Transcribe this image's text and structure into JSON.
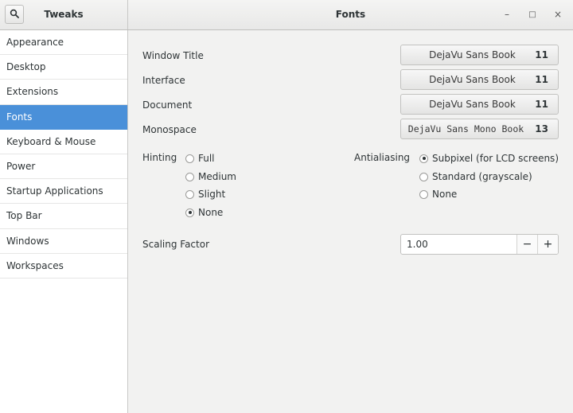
{
  "header": {
    "app_title": "Tweaks",
    "window_title": "Fonts",
    "minimize_glyph": "–",
    "maximize_glyph": "□",
    "close_glyph": "×"
  },
  "sidebar": {
    "items": [
      {
        "label": "Appearance"
      },
      {
        "label": "Desktop"
      },
      {
        "label": "Extensions"
      },
      {
        "label": "Fonts",
        "active": true
      },
      {
        "label": "Keyboard & Mouse"
      },
      {
        "label": "Power"
      },
      {
        "label": "Startup Applications"
      },
      {
        "label": "Top Bar"
      },
      {
        "label": "Windows"
      },
      {
        "label": "Workspaces"
      }
    ]
  },
  "fonts": {
    "rows": [
      {
        "label": "Window Title",
        "font": "DejaVu Sans Book",
        "size": "11"
      },
      {
        "label": "Interface",
        "font": "DejaVu Sans Book",
        "size": "11"
      },
      {
        "label": "Document",
        "font": "DejaVu Sans Book",
        "size": "11"
      },
      {
        "label": "Monospace",
        "font": "DejaVu Sans Mono Book",
        "size": "13"
      }
    ]
  },
  "hinting": {
    "label": "Hinting",
    "options": [
      "Full",
      "Medium",
      "Slight",
      "None"
    ],
    "selected": "None"
  },
  "antialiasing": {
    "label": "Antialiasing",
    "options": [
      "Subpixel (for LCD screens)",
      "Standard (grayscale)",
      "None"
    ],
    "selected": "Subpixel (for LCD screens)"
  },
  "scaling": {
    "label": "Scaling Factor",
    "value": "1.00",
    "minus": "−",
    "plus": "+"
  },
  "colors": {
    "accent": "#4a90d9"
  }
}
